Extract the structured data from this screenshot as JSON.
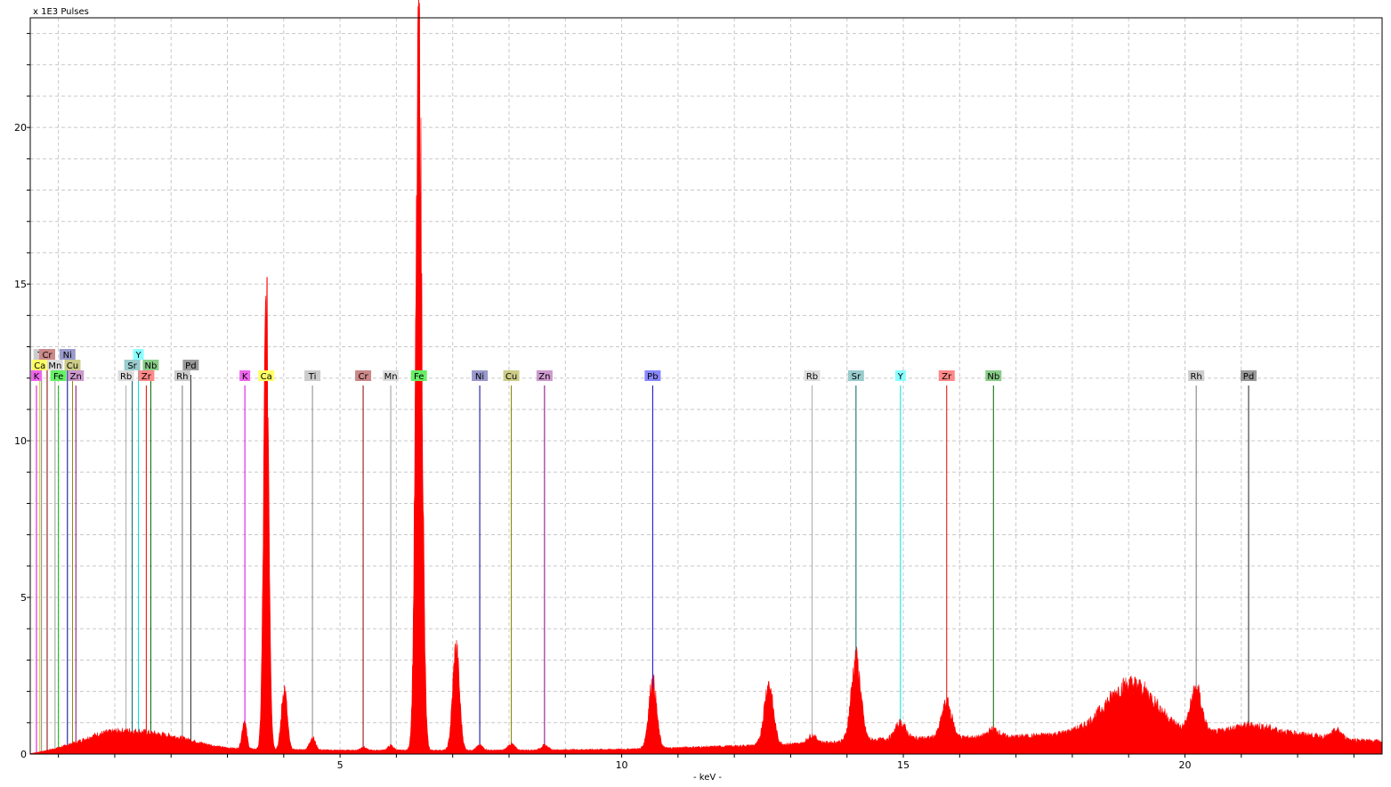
{
  "chart_data": {
    "type": "area",
    "ylabel": "x 1E3 Pulses",
    "xlabel": "- keV -",
    "xlim": [
      -0.5,
      23.5
    ],
    "ylim": [
      0,
      23.5
    ],
    "x_ticks": [
      5,
      10,
      15,
      20
    ],
    "y_ticks": [
      5,
      10,
      15,
      20
    ],
    "grid": true,
    "spectrum_color": "#ff0000",
    "peaks": [
      {
        "x": 1.0,
        "y": 0.3,
        "w": 0.6
      },
      {
        "x": 1.45,
        "y": 0.2,
        "w": 0.5
      },
      {
        "x": 2.2,
        "y": 0.2,
        "w": 0.4
      },
      {
        "x": 3.3,
        "y": 0.9,
        "w": 0.04
      },
      {
        "x": 3.69,
        "y": 14.2,
        "w": 0.045
      },
      {
        "x": 4.01,
        "y": 1.95,
        "w": 0.05
      },
      {
        "x": 4.51,
        "y": 0.4,
        "w": 0.05
      },
      {
        "x": 5.41,
        "y": 0.1,
        "w": 0.05
      },
      {
        "x": 5.9,
        "y": 0.15,
        "w": 0.05
      },
      {
        "x": 6.4,
        "y": 22.1,
        "w": 0.055
      },
      {
        "x": 7.06,
        "y": 3.25,
        "w": 0.06
      },
      {
        "x": 7.48,
        "y": 0.15,
        "w": 0.06
      },
      {
        "x": 8.04,
        "y": 0.2,
        "w": 0.06
      },
      {
        "x": 8.63,
        "y": 0.15,
        "w": 0.06
      },
      {
        "x": 10.55,
        "y": 2.15,
        "w": 0.07
      },
      {
        "x": 12.61,
        "y": 1.95,
        "w": 0.08
      },
      {
        "x": 13.38,
        "y": 0.25,
        "w": 0.08
      },
      {
        "x": 14.16,
        "y": 2.6,
        "w": 0.085
      },
      {
        "x": 14.95,
        "y": 0.5,
        "w": 0.09
      },
      {
        "x": 15.77,
        "y": 1.1,
        "w": 0.09
      },
      {
        "x": 16.6,
        "y": 0.25,
        "w": 0.1
      },
      {
        "x": 19.05,
        "y": 1.6,
        "w": 0.45
      },
      {
        "x": 20.2,
        "y": 1.4,
        "w": 0.1
      },
      {
        "x": 21.1,
        "y": 0.2,
        "w": 0.3
      },
      {
        "x": 22.7,
        "y": 0.25,
        "w": 0.08
      }
    ],
    "background": [
      {
        "x": -0.5,
        "y": 0.0
      },
      {
        "x": 0.7,
        "y": 0.3
      },
      {
        "x": 2.5,
        "y": 0.18
      },
      {
        "x": 5.0,
        "y": 0.12
      },
      {
        "x": 8.0,
        "y": 0.12
      },
      {
        "x": 10.0,
        "y": 0.15
      },
      {
        "x": 12.0,
        "y": 0.25
      },
      {
        "x": 13.5,
        "y": 0.35
      },
      {
        "x": 15.0,
        "y": 0.5
      },
      {
        "x": 17.0,
        "y": 0.55
      },
      {
        "x": 18.0,
        "y": 0.65
      },
      {
        "x": 20.0,
        "y": 0.6
      },
      {
        "x": 21.5,
        "y": 0.75
      },
      {
        "x": 23.0,
        "y": 0.45
      },
      {
        "x": 23.5,
        "y": 0.4
      }
    ],
    "element_markers": [
      {
        "label": "K",
        "x": 3.31,
        "row": 0,
        "color": "#ee66ee"
      },
      {
        "label": "Ca",
        "x": 3.69,
        "row": 0,
        "color": "#ffff66"
      },
      {
        "label": "Ti",
        "x": 4.51,
        "row": 0,
        "color": "#cccccc"
      },
      {
        "label": "Cr",
        "x": 5.41,
        "row": 0,
        "color": "#cc8888"
      },
      {
        "label": "Mn",
        "x": 5.9,
        "row": 0,
        "color": "#dddddd"
      },
      {
        "label": "Fe",
        "x": 6.4,
        "row": 0,
        "color": "#66ee66"
      },
      {
        "label": "Ni",
        "x": 7.48,
        "row": 0,
        "color": "#9999cc"
      },
      {
        "label": "Cu",
        "x": 8.04,
        "row": 0,
        "color": "#cccc88"
      },
      {
        "label": "Zn",
        "x": 8.63,
        "row": 0,
        "color": "#cc99cc"
      },
      {
        "label": "Pb",
        "x": 10.55,
        "row": 0,
        "color": "#8888ff"
      },
      {
        "label": "Rb",
        "x": 13.38,
        "row": 0,
        "color": "#dddddd"
      },
      {
        "label": "Sr",
        "x": 14.16,
        "row": 0,
        "color": "#99cccc"
      },
      {
        "label": "Y",
        "x": 14.95,
        "row": 0,
        "color": "#88ffff"
      },
      {
        "label": "Zr",
        "x": 15.77,
        "row": 0,
        "color": "#ff8888"
      },
      {
        "label": "Nb",
        "x": 16.6,
        "row": 0,
        "color": "#88cc88"
      },
      {
        "label": "Rh",
        "x": 20.2,
        "row": 0,
        "color": "#cccccc"
      },
      {
        "label": "Pd",
        "x": 21.13,
        "row": 0,
        "color": "#999999"
      },
      {
        "label": "K",
        "x": -0.39,
        "row": 0,
        "color": "#ee66ee"
      },
      {
        "label": "Fe",
        "x": 0.0,
        "row": 0,
        "color": "#66ee66"
      },
      {
        "label": "Zn",
        "x": 0.31,
        "row": 0,
        "color": "#cc99cc"
      },
      {
        "label": "Rb",
        "x": 1.2,
        "row": 0,
        "color": "#dddddd"
      },
      {
        "label": "Zr",
        "x": 1.56,
        "row": 0,
        "color": "#ff8888"
      },
      {
        "label": "Rh",
        "x": 2.2,
        "row": 0,
        "color": "#cccccc"
      },
      {
        "label": "Ca",
        "x": -0.33,
        "row": 1,
        "color": "#ffff66"
      },
      {
        "label": "Mn",
        "x": -0.06,
        "row": 1,
        "color": "#dddddd"
      },
      {
        "label": "Cu",
        "x": 0.25,
        "row": 1,
        "color": "#cccc88"
      },
      {
        "label": "Sr",
        "x": 1.31,
        "row": 1,
        "color": "#99cccc"
      },
      {
        "label": "Nb",
        "x": 1.64,
        "row": 1,
        "color": "#88cc88"
      },
      {
        "label": "Pd",
        "x": 2.35,
        "row": 1,
        "color": "#999999"
      },
      {
        "label": "Ti",
        "x": -0.3,
        "row": 2,
        "color": "#cccccc"
      },
      {
        "label": "Cr",
        "x": -0.2,
        "row": 2,
        "color": "#cc8888"
      },
      {
        "label": "Ni",
        "x": 0.16,
        "row": 2,
        "color": "#9999cc"
      },
      {
        "label": "Y",
        "x": 1.42,
        "row": 2,
        "color": "#88ffff"
      }
    ],
    "marker_line_colors": {
      "K": "#dd00dd",
      "Ca": "#cccc00",
      "Ti": "#888888",
      "Cr": "#880000",
      "Mn": "#999999",
      "Fe": "#00bb00",
      "Ni": "#000099",
      "Cu": "#888800",
      "Zn": "#880088",
      "Pb": "#0000cc",
      "Rb": "#aaaaaa",
      "Sr": "#006666",
      "Y": "#00dddd",
      "Zr": "#ee0000",
      "Nb": "#006600",
      "Rh": "#777777",
      "Pd": "#222222"
    }
  }
}
